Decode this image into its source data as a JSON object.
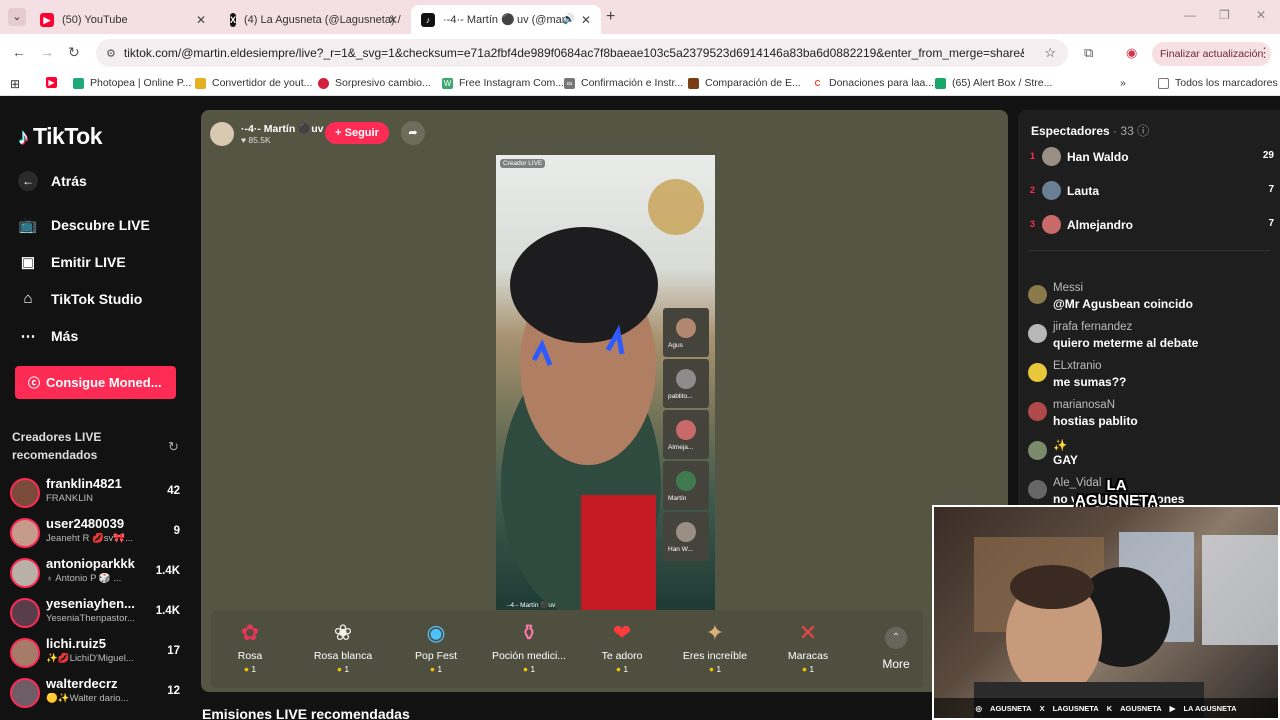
{
  "browser": {
    "tabs": [
      {
        "title": "(50) YouTube",
        "icon": "youtube-icon"
      },
      {
        "title": "(4) La Agusneta (@Lagusneta) /",
        "icon": "x-icon"
      },
      {
        "title": "·-4·- Martín ⚫ uv (@mar",
        "icon": "tiktok-icon"
      }
    ],
    "url": "tiktok.com/@martin.eldesiempre/live?_r=1&_svg=1&checksum=e71a2fbf4de989f0684ac7f8baeae103c5a2379523d6914146a83ba6d0882219&enter_from_merge=share&enter_metho...",
    "update_label": "Finalizar actualización",
    "bookmarks": [
      "Photopea | Online P...",
      "Convertidor de yout...",
      "Sorpresivo cambio...",
      "Free Instagram Com...",
      "Confirmación e Instr...",
      "Comparación de E...",
      "Donaciones para laa...",
      "(65) Alert Box / Stre..."
    ],
    "all_bookmarks": "Todos los marcadores"
  },
  "sidebar": {
    "logo": "TikTok",
    "back": "Atrás",
    "nav": [
      "Descubre LIVE",
      "Emitir LIVE",
      "TikTok Studio",
      "Más"
    ],
    "coins_button": "Consigue Moned...",
    "recommended_title": "Creadores LIVE recomendados",
    "creators": [
      {
        "name": "franklin4821",
        "sub": "FRANKLIN",
        "count": "42"
      },
      {
        "name": "user2480039",
        "sub": "Jeaneht R 💋sv🎀...",
        "count": "9"
      },
      {
        "name": "antonioparkkk",
        "sub": "♁ Antonio P 🎲 ...",
        "count": "1.4K"
      },
      {
        "name": "yeseniayhen...",
        "sub": "YeseniaThenpastor...",
        "count": "1.4K"
      },
      {
        "name": "lichi.ruiz5",
        "sub": "✨💋LichiD'Miguel...",
        "count": "17"
      },
      {
        "name": "walterdecrz",
        "sub": "🟡✨Walter dario...",
        "count": "12"
      }
    ]
  },
  "live": {
    "host_name": "·-4·- Martín ⚫uv",
    "host_likes": "85.5K",
    "follow_label": "+ Seguir",
    "video_label": "Creador LIVE",
    "video_footer": "·-4·- Martín ⚫uv",
    "guests": [
      "Agus",
      "pablito...",
      "Almeja...",
      "Martín",
      "Han W..."
    ],
    "gifts": [
      {
        "name": "Rosa",
        "price": "1",
        "icon": "rose-icon"
      },
      {
        "name": "Rosa blanca",
        "price": "1",
        "icon": "white-rose-icon"
      },
      {
        "name": "Pop Fest",
        "price": "1",
        "icon": "pop-fest-icon"
      },
      {
        "name": "Poción medici...",
        "price": "1",
        "icon": "potion-icon"
      },
      {
        "name": "Te adoro",
        "price": "1",
        "icon": "heart-icon"
      },
      {
        "name": "Eres increíble",
        "price": "1",
        "icon": "cat-icon"
      },
      {
        "name": "Maracas",
        "price": "1",
        "icon": "maracas-icon"
      }
    ],
    "more_label": "More",
    "section_title": "Emisiones LIVE recomendadas"
  },
  "viewers": {
    "title": "Espectadores",
    "count": "33",
    "list": [
      {
        "rank": "1",
        "name": "Han Waldo",
        "score": "29"
      },
      {
        "rank": "2",
        "name": "Lauta",
        "score": "7"
      },
      {
        "rank": "3",
        "name": "Almejandro",
        "score": "7"
      }
    ]
  },
  "chat": [
    {
      "user": "Messi",
      "text": "@Mr Agusbean coincido"
    },
    {
      "user": "jirafa fernandez",
      "text": "quiero meterme al debate"
    },
    {
      "user": "ELxtranio",
      "text": "me sumas??"
    },
    {
      "user": "marianosaN",
      "text": "hostias pablito"
    },
    {
      "user": "✨",
      "text": "GAY"
    },
    {
      "user": "Ale_Vidal",
      "text": "no ve... las intenciones"
    }
  ],
  "overlay": {
    "brand_line1": "LA",
    "brand_line2": "AGUSNETA",
    "socials": [
      "AGUSNETA",
      "LAGUSNETA",
      "AGUSNETA",
      "LA AGUSNETA"
    ]
  },
  "colors": {
    "accent": "#fe2c55",
    "player_bg": "#555544",
    "page_bg": "#121212"
  }
}
